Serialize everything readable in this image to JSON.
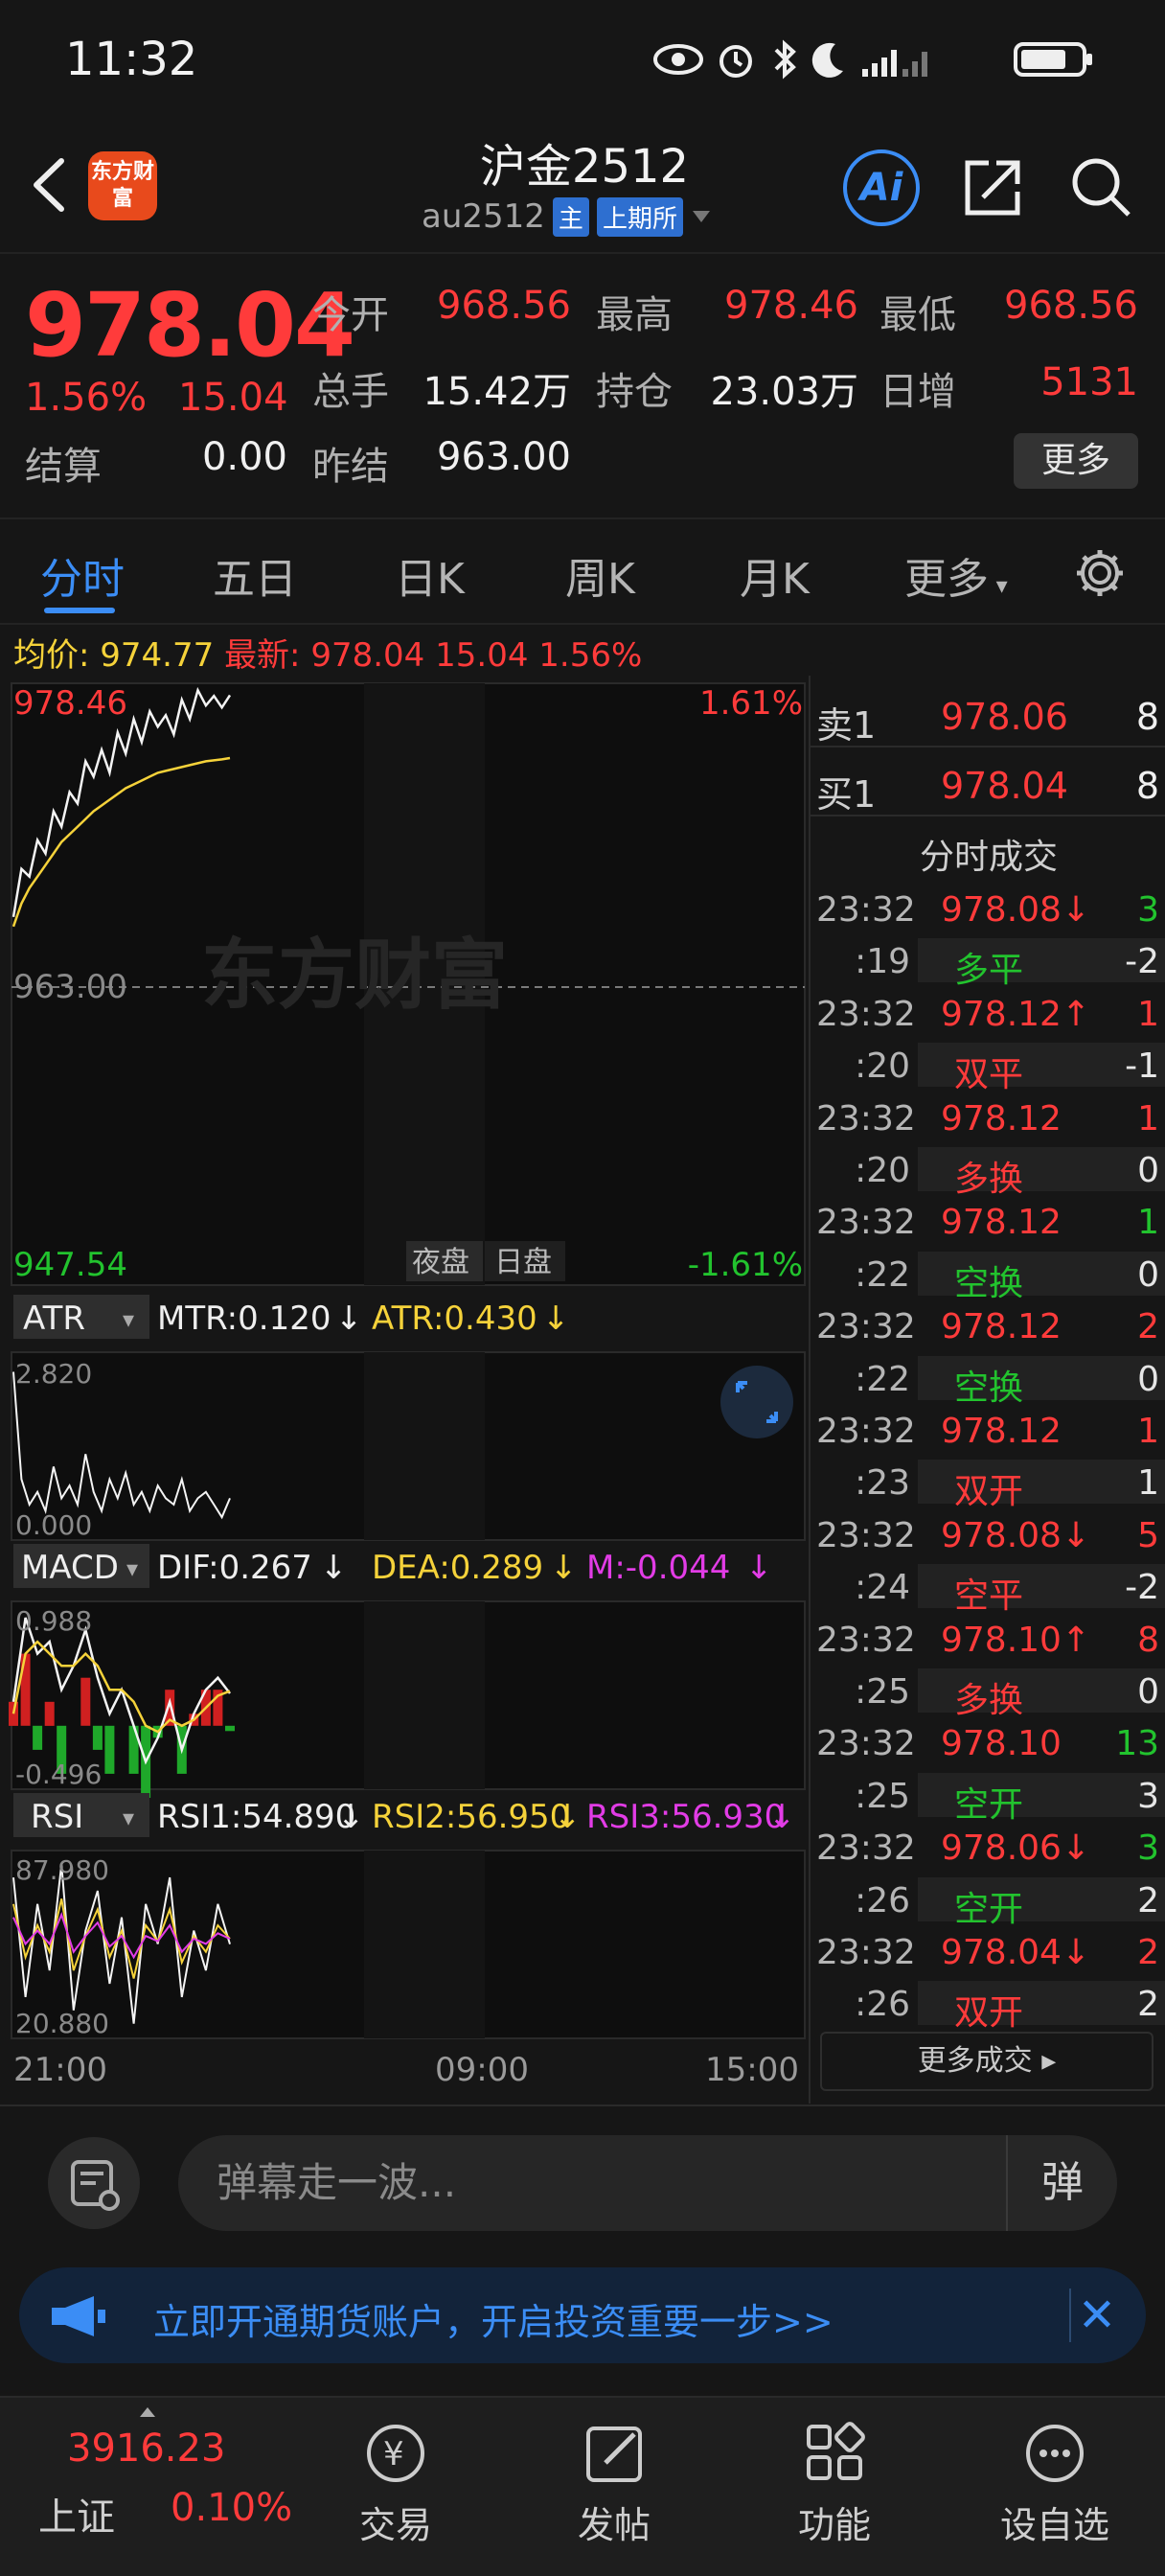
{
  "status": {
    "time": "11:32"
  },
  "header": {
    "title": "沪金2512",
    "code": "au2512",
    "tag_main": "主",
    "exchange": "上期所",
    "logo_text": "东方财富"
  },
  "quote": {
    "last_price": "978.04",
    "change_pct": "1.56%",
    "change_amt": "15.04",
    "settle_label": "结算",
    "settle_value": "0.00",
    "open_label": "今开",
    "open_value": "968.56",
    "high_label": "最高",
    "high_value": "978.46",
    "low_label": "最低",
    "low_value": "968.56",
    "volume_label": "总手",
    "volume_value": "15.42万",
    "oi_label": "持仓",
    "oi_value": "23.03万",
    "daily_inc_label": "日增",
    "daily_inc_value": "5131",
    "prev_settle_label": "昨结",
    "prev_settle_value": "963.00",
    "more_label": "更多"
  },
  "tabs": [
    "分时",
    "五日",
    "日K",
    "周K",
    "月K",
    "更多"
  ],
  "info_line": {
    "avg_label": "均价:",
    "avg_value": "974.77",
    "latest_label": "最新:",
    "latest_value": "978.04",
    "latest_change": "15.04",
    "latest_pct": "1.56%"
  },
  "chart_data": {
    "type": "line",
    "price_top_label": "978.46",
    "price_mid_label": "963.00",
    "price_bottom_label": "947.54",
    "pct_top": "1.61%",
    "pct_bottom": "-1.61%",
    "ylim": [
      947.54,
      978.46
    ],
    "prev_settle": 963.0,
    "night_label": "夜盘",
    "day_label": "日盘",
    "watermark": "东方财富",
    "x_ticks": [
      "21:00",
      "09:00",
      "15:00"
    ],
    "series": [
      {
        "values": [
          966.5,
          969.0,
          968.6,
          970.5,
          969.8,
          972.0,
          971.2,
          973.0,
          972.4,
          974.6,
          973.8,
          975.2,
          974.0,
          976.1,
          975.0,
          976.8,
          975.6,
          977.2,
          976.4,
          977.0,
          976.0,
          977.8,
          976.8,
          978.3,
          977.5,
          978.0,
          977.4,
          978.04
        ]
      },
      {
        "values": [
          966.0,
          967.2,
          968.0,
          968.6,
          969.2,
          969.8,
          970.4,
          970.8,
          971.2,
          971.6,
          972.0,
          972.3,
          972.6,
          972.9,
          973.2,
          973.4,
          973.6,
          973.8,
          974.0,
          974.1,
          974.2,
          974.3,
          974.4,
          974.5,
          974.6,
          974.65,
          974.7,
          974.77
        ]
      }
    ]
  },
  "atr": {
    "name": "ATR",
    "mtr": "MTR:0.120",
    "atr": "ATR:0.430",
    "top": "2.820",
    "bottom": "0.000",
    "values": [
      2.6,
      0.9,
      0.5,
      0.7,
      0.4,
      1.1,
      0.6,
      0.8,
      0.5,
      1.3,
      0.7,
      0.4,
      0.9,
      0.6,
      1.0,
      0.5,
      0.7,
      0.4,
      0.8,
      0.6,
      0.5,
      0.9,
      0.4,
      0.6,
      0.7,
      0.5,
      0.3,
      0.6
    ]
  },
  "macd": {
    "name": "MACD",
    "dif": "DIF:0.267",
    "dea": "DEA:0.289",
    "m": "M:-0.044",
    "top": "0.988",
    "bottom": "-0.496",
    "dif_values": [
      0.2,
      0.9,
      0.6,
      0.7,
      0.3,
      0.5,
      0.8,
      0.4,
      0.1,
      0.3,
      0.0,
      -0.3,
      -0.1,
      0.2,
      -0.2,
      0.1,
      0.3,
      0.4,
      0.27
    ],
    "dea_values": [
      0.1,
      0.6,
      0.7,
      0.6,
      0.5,
      0.5,
      0.6,
      0.5,
      0.3,
      0.3,
      0.2,
      0.0,
      -0.05,
      0.05,
      0.0,
      0.05,
      0.15,
      0.25,
      0.289
    ],
    "m_values": [
      0.2,
      0.6,
      -0.2,
      0.2,
      -0.4,
      0.0,
      0.4,
      -0.2,
      -0.4,
      0.0,
      -0.4,
      -0.6,
      -0.1,
      0.3,
      -0.4,
      0.1,
      0.3,
      0.3,
      -0.044
    ]
  },
  "rsi": {
    "name": "RSI",
    "rsi1": "RSI1:54.890",
    "rsi2": "RSI2:56.950",
    "rsi3": "RSI3:56.930",
    "top": "87.980",
    "bottom": "20.880",
    "rsi1_values": [
      80,
      35,
      70,
      45,
      85,
      30,
      60,
      75,
      40,
      65,
      25,
      70,
      55,
      80,
      35,
      60,
      45,
      70,
      54.9
    ],
    "rsi2_values": [
      70,
      50,
      62,
      52,
      72,
      45,
      58,
      68,
      50,
      60,
      42,
      62,
      56,
      68,
      48,
      58,
      52,
      62,
      56.95
    ],
    "rsi3_values": [
      65,
      55,
      60,
      55,
      66,
      52,
      58,
      63,
      54,
      58,
      50,
      58,
      56,
      62,
      52,
      57,
      55,
      59,
      56.93
    ]
  },
  "orderbook": {
    "sell_label": "卖1",
    "sell_price": "978.06",
    "sell_qty": "8",
    "buy_label": "买1",
    "buy_price": "978.04",
    "buy_qty": "8",
    "trades_title": "分时成交"
  },
  "trades": [
    {
      "time": "23:32",
      "price": "978.08↓",
      "qty": "3",
      "pc": "red",
      "qc": "green"
    },
    {
      "time": ":19",
      "price": "多平",
      "qty": "-2",
      "pc": "green",
      "qc": "white"
    },
    {
      "time": "23:32",
      "price": "978.12↑",
      "qty": "1",
      "pc": "red",
      "qc": "red"
    },
    {
      "time": ":20",
      "price": "双平",
      "qty": "-1",
      "pc": "red",
      "qc": "white"
    },
    {
      "time": "23:32",
      "price": "978.12",
      "qty": "1",
      "pc": "red",
      "qc": "red"
    },
    {
      "time": ":20",
      "price": "多换",
      "qty": "0",
      "pc": "red",
      "qc": "white"
    },
    {
      "time": "23:32",
      "price": "978.12",
      "qty": "1",
      "pc": "red",
      "qc": "green"
    },
    {
      "time": ":22",
      "price": "空换",
      "qty": "0",
      "pc": "green",
      "qc": "white"
    },
    {
      "time": "23:32",
      "price": "978.12",
      "qty": "2",
      "pc": "red",
      "qc": "red"
    },
    {
      "time": ":22",
      "price": "空换",
      "qty": "0",
      "pc": "green",
      "qc": "white"
    },
    {
      "time": "23:32",
      "price": "978.12",
      "qty": "1",
      "pc": "red",
      "qc": "red"
    },
    {
      "time": ":23",
      "price": "双开",
      "qty": "1",
      "pc": "red",
      "qc": "white"
    },
    {
      "time": "23:32",
      "price": "978.08↓",
      "qty": "5",
      "pc": "red",
      "qc": "red"
    },
    {
      "time": ":24",
      "price": "空平",
      "qty": "-2",
      "pc": "red",
      "qc": "white"
    },
    {
      "time": "23:32",
      "price": "978.10↑",
      "qty": "8",
      "pc": "red",
      "qc": "red"
    },
    {
      "time": ":25",
      "price": "多换",
      "qty": "0",
      "pc": "red",
      "qc": "white"
    },
    {
      "time": "23:32",
      "price": "978.10",
      "qty": "13",
      "pc": "red",
      "qc": "green"
    },
    {
      "time": ":25",
      "price": "空开",
      "qty": "3",
      "pc": "green",
      "qc": "white"
    },
    {
      "time": "23:32",
      "price": "978.06↓",
      "qty": "3",
      "pc": "red",
      "qc": "green"
    },
    {
      "time": ":26",
      "price": "空开",
      "qty": "2",
      "pc": "green",
      "qc": "white"
    },
    {
      "time": "23:32",
      "price": "978.04↓",
      "qty": "2",
      "pc": "red",
      "qc": "red"
    },
    {
      "time": ":26",
      "price": "双开",
      "qty": "2",
      "pc": "red",
      "qc": "white"
    }
  ],
  "more_trades_label": "更多成交 ▸",
  "comment": {
    "placeholder": "弹幕走一波...",
    "danmu_label": "弹"
  },
  "banner": {
    "text": "立即开通期货账户，开启投资重要一步>>",
    "close": "✕"
  },
  "bottom_nav": {
    "index_value": "3916.23",
    "index_name": "上证",
    "index_change": "0.10%",
    "items": [
      "交易",
      "发帖",
      "功能",
      "设自选"
    ]
  },
  "colors": {
    "up": "#ff3b3b",
    "down": "#22c32e",
    "accent": "#3b8df5"
  }
}
